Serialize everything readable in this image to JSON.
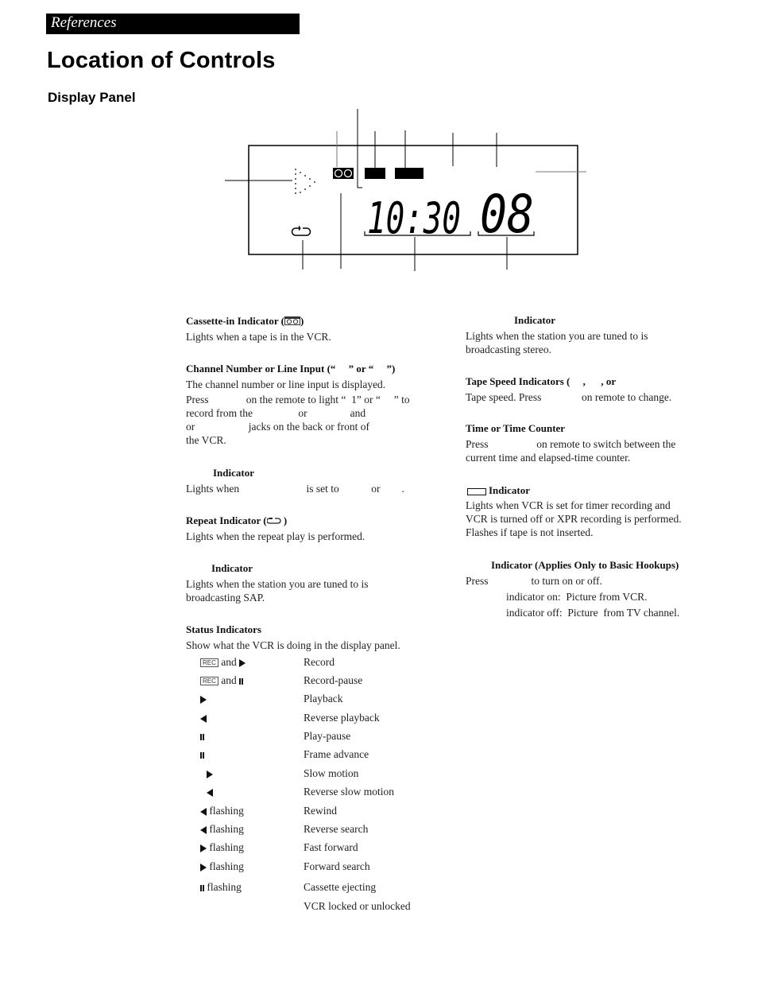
{
  "header": {
    "section_label": "References",
    "page_title": "Location of Controls",
    "subsection_title": "Display Panel"
  },
  "display_panel": {
    "time_digits": "10:30",
    "channel_digits": "08",
    "icons": [
      "dotted-play-triangle-icon",
      "cassette-icon",
      "indicator-block-1",
      "indicator-block-2",
      "repeat-icon"
    ]
  },
  "left_column": {
    "cassette": {
      "title": "Cassette-in Indicator (",
      "title_end": ")",
      "body": "Lights when a tape is in the VCR."
    },
    "channel": {
      "title": "Channel Number or Line Input (“     ” or “     ”)",
      "line1": "The channel number or line input is displayed.",
      "line2": "Press              on the remote to light “  1” or “     ” to",
      "line3": "record from the                 or                and",
      "line4": "or                    jacks on the back or front of",
      "line5": "the VCR."
    },
    "indicator_a": {
      "title": "Indicator",
      "body": "Lights when                         is set to            or        ."
    },
    "repeat": {
      "title": "Repeat Indicator (",
      "title_end": " )",
      "body": "Lights when the repeat play is performed."
    },
    "sap": {
      "title": "Indicator",
      "line1": "Lights when the station you are tuned to is",
      "line2": "broadcasting SAP."
    },
    "status": {
      "title": "Status Indicators",
      "body": "Show what the VCR is doing in the display panel.",
      "rows": [
        {
          "symbol": "rec+play",
          "label": "and",
          "meaning": "Record"
        },
        {
          "symbol": "rec+pause",
          "label": "and",
          "meaning": "Record-pause"
        },
        {
          "symbol": "play",
          "label": "",
          "meaning": "Playback"
        },
        {
          "symbol": "reverse",
          "label": "",
          "meaning": "Reverse playback"
        },
        {
          "symbol": "pause",
          "label": "",
          "meaning": "Play-pause"
        },
        {
          "symbol": "pause",
          "label": "",
          "meaning": "Frame advance"
        },
        {
          "symbol": "play-indent",
          "label": "",
          "meaning": "Slow motion"
        },
        {
          "symbol": "reverse-indent",
          "label": "",
          "meaning": "Reverse slow motion"
        },
        {
          "symbol": "reverse",
          "label": "flashing",
          "meaning": "Rewind"
        },
        {
          "symbol": "reverse",
          "label": "flashing",
          "meaning": "Reverse search"
        },
        {
          "symbol": "play",
          "label": "flashing",
          "meaning": "Fast forward"
        },
        {
          "symbol": "play",
          "label": "flashing",
          "meaning": "Forward search"
        },
        {
          "symbol": "pause",
          "label": "flashing",
          "meaning": "Cassette ejecting"
        },
        {
          "symbol": "none",
          "label": "",
          "meaning": "VCR locked or unlocked"
        }
      ],
      "rec_text": "REC"
    }
  },
  "right_column": {
    "stereo": {
      "title": "Indicator",
      "line1": "Lights when the station you are tuned to is",
      "line2": "broadcasting stereo."
    },
    "tape_speed": {
      "title": "Tape Speed Indicators (     ,      , or",
      "body": "Tape speed. Press               on remote to change."
    },
    "time": {
      "title": "Time or Time Counter",
      "line1": "Press                  on remote to switch between the",
      "line2": "current time and elapsed-time counter."
    },
    "timer": {
      "title": "Indicator",
      "line1": "Lights when VCR is set for timer recording and",
      "line2": "VCR is turned off or XPR recording is performed.",
      "line3": "Flashes if tape is not inserted."
    },
    "vcr_tv": {
      "title": "Indicator (Applies Only to Basic Hookups)",
      "line1": "Press                to turn on or off.",
      "line2": "indicator on:  Picture from VCR.",
      "line3": "indicator off:  Picture  from TV channel."
    }
  }
}
